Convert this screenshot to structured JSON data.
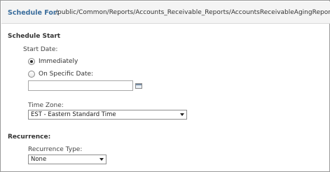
{
  "header": {
    "schedule_for_label": "Schedule For:",
    "report_path": "/public/Common/Reports/Accounts_Receivable_Reports/AccountsReceivableAgingReport"
  },
  "schedule_start": {
    "title": "Schedule Start",
    "start_date_label": "Start Date:",
    "options": [
      {
        "label": "Immediately",
        "selected": true
      },
      {
        "label": "On Specific Date:",
        "selected": false
      }
    ],
    "specific_date_value": "",
    "calendar_icon": "calendar-icon",
    "time_zone_label": "Time Zone:",
    "time_zone_value": "EST - Eastern Standard Time"
  },
  "recurrence": {
    "title": "Recurrence:",
    "type_label": "Recurrence Type:",
    "type_value": "None"
  },
  "colors": {
    "header_label": "#3a6d9c",
    "header_background": "#f4f4f4",
    "frame_border": "#9a9a9a"
  }
}
